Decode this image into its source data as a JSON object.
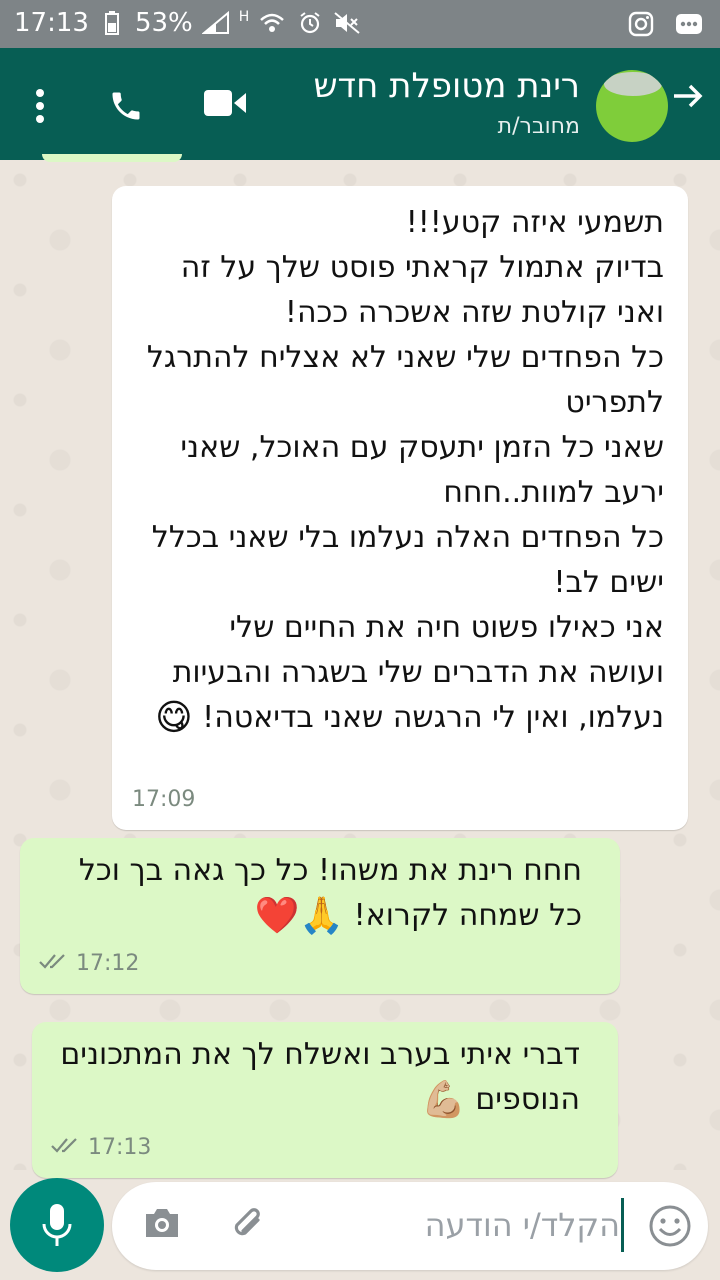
{
  "status_bar": {
    "time": "17:13",
    "battery": "53%",
    "signal_label": "H"
  },
  "header": {
    "contact_name": "רינת מטופלת חדש",
    "contact_status": "מחובר/ת",
    "back_icon": "arrow-right-icon",
    "video_icon": "video-call-icon",
    "call_icon": "phone-icon",
    "menu_icon": "more-vert-icon"
  },
  "messages": [
    {
      "direction": "incoming",
      "text": "תשמעי איזה קטע!!!\nבדיוק אתמול קראתי פוסט שלך על זה ואני קולטת שזה אשכרה ככה!\nכל הפחדים שלי שאני לא אצליח להתרגל לתפריט\nשאני כל הזמן יתעסק עם האוכל, שאני ירעב למוות..חחח\nכל הפחדים האלה נעלמו בלי שאני בכלל ישים לב!\nאני כאילו פשוט חיה את החיים שלי ועושה את הדברים שלי בשגרה והבעיות נעלמו, ואין לי הרגשה שאני בדיאטה!",
      "emoji": "😋",
      "time": "17:09"
    },
    {
      "direction": "outgoing",
      "text": "חחח רינת את משהו! כל כך גאה בך וכל כל שמחה לקרוא!",
      "emoji": "🙏❤️",
      "time": "17:12"
    },
    {
      "direction": "outgoing",
      "text": "דברי איתי בערב ואשלח לך את המתכונים הנוספים",
      "emoji": "💪🏼",
      "time": "17:13"
    }
  ],
  "input": {
    "placeholder": "הקלד/י הודעה",
    "emoji_icon": "smiley-icon",
    "attach_icon": "paperclip-icon",
    "camera_icon": "camera-icon",
    "mic_icon": "mic-icon"
  },
  "colors": {
    "header": "#075e54",
    "outgoing_bubble": "#dcf8c6",
    "incoming_bubble": "#ffffff",
    "accent": "#00897b"
  }
}
